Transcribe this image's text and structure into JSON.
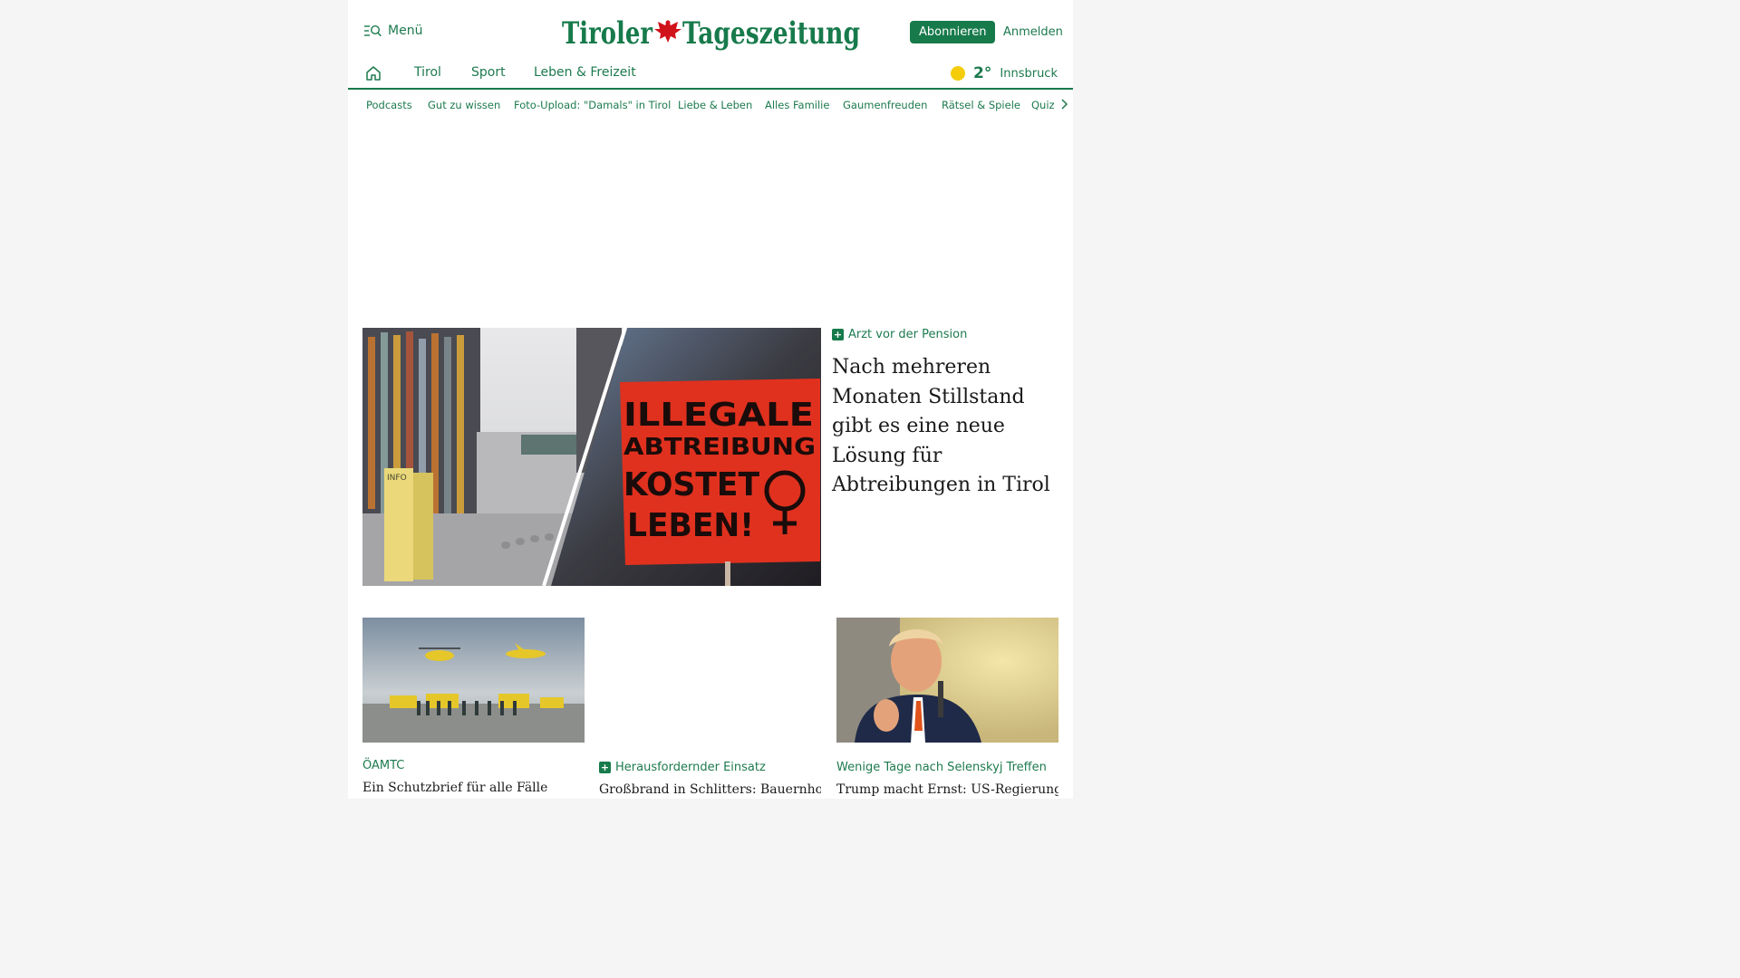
{
  "header": {
    "menu_label": "Menü",
    "logo_text_left": "Tiroler",
    "logo_text_right": "Tageszeitung",
    "subscribe_label": "Abonnieren",
    "login_label": "Anmelden"
  },
  "mainnav": {
    "items": [
      {
        "label": "Tirol"
      },
      {
        "label": "Sport"
      },
      {
        "label": "Leben & Freizeit"
      }
    ],
    "weather": {
      "temp": "2°",
      "city": "Innsbruck"
    }
  },
  "subnav": {
    "items": [
      {
        "label": "Podcasts"
      },
      {
        "label": "Gut zu wissen"
      },
      {
        "label": "Foto-Upload: \"Damals\" in Tirol"
      },
      {
        "label": "Liebe & Leben"
      },
      {
        "label": "Alles Familie"
      },
      {
        "label": "Gaumenfreuden"
      },
      {
        "label": "Rätsel & Spiele"
      },
      {
        "label": "Quiz"
      }
    ]
  },
  "lead": {
    "kicker": "Arzt vor der Pension",
    "title": "Nach mehreren Monaten Stillstand gibt es eine neue Lösung für Abtreibungen in Tirol",
    "sign_lines": [
      "ILLEGALE",
      "ABTREIBUNG",
      "KOSTET",
      "LEBEN!"
    ],
    "info_label": "INFO"
  },
  "teasers": [
    {
      "kicker": "ÖAMTC",
      "premium": false,
      "title": "Ein Schutzbrief für alle Fälle"
    },
    {
      "kicker": "Herausfordernder Einsatz",
      "premium": true,
      "title": "Großbrand in Schlitters: Bauernhof in"
    },
    {
      "kicker": "Wenige Tage nach Selenskyj Treffen",
      "premium": false,
      "title": "Trump macht Ernst: US-Regierung"
    }
  ],
  "colors": {
    "brand_green": "#177a4b",
    "link_green": "#1d7a4e",
    "sun_yellow": "#f5cc0a",
    "eagle_red": "#d0121b"
  }
}
